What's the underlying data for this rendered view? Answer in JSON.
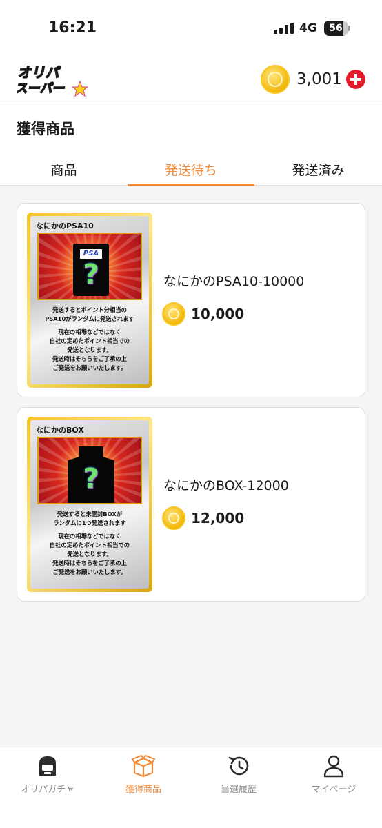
{
  "status_bar": {
    "time": "16:21",
    "network": "4G",
    "battery": "56"
  },
  "header": {
    "logo_text": "オリパスーパー",
    "balance": "3,001",
    "colors": {
      "accent": "#ef8a3a",
      "plus": "#e21c2b",
      "coin": "#f2b90a"
    }
  },
  "page": {
    "title": "獲得商品"
  },
  "tabs": [
    {
      "label": "商品",
      "active": false
    },
    {
      "label": "発送待ち",
      "active": true
    },
    {
      "label": "発送済み",
      "active": false
    }
  ],
  "items": [
    {
      "card_title": "なにかのPSA10",
      "card_badge": "PSA",
      "card_lines_1": [
        "発送するとポイント分相当の",
        "PSA10がランダムに発送されます"
      ],
      "card_lines_2": [
        "現在の相場などではなく",
        "自社の定めたポイント相当での",
        "発送となります。",
        "発送時はそちらをご了承の上",
        "ご発送をお願いいたします。"
      ],
      "name": "なにかのPSA10-10000",
      "price": "10,000"
    },
    {
      "card_title": "なにかのBOX",
      "card_lines_1": [
        "発送すると未開封BOXが",
        "ランダムに1つ発送されます"
      ],
      "card_lines_2": [
        "現在の相場などではなく",
        "自社の定めたポイント相当での",
        "発送となります。",
        "発送時はそちらをご了承の上",
        "ご発送をお願いいたします。"
      ],
      "name": "なにかのBOX-12000",
      "price": "12,000"
    }
  ],
  "bottom_nav": [
    {
      "label": "オリパガチャ",
      "icon": "gacha-machine-icon"
    },
    {
      "label": "獲得商品",
      "icon": "box-icon",
      "active": true
    },
    {
      "label": "当選履歴",
      "icon": "history-icon"
    },
    {
      "label": "マイページ",
      "icon": "user-icon"
    }
  ]
}
